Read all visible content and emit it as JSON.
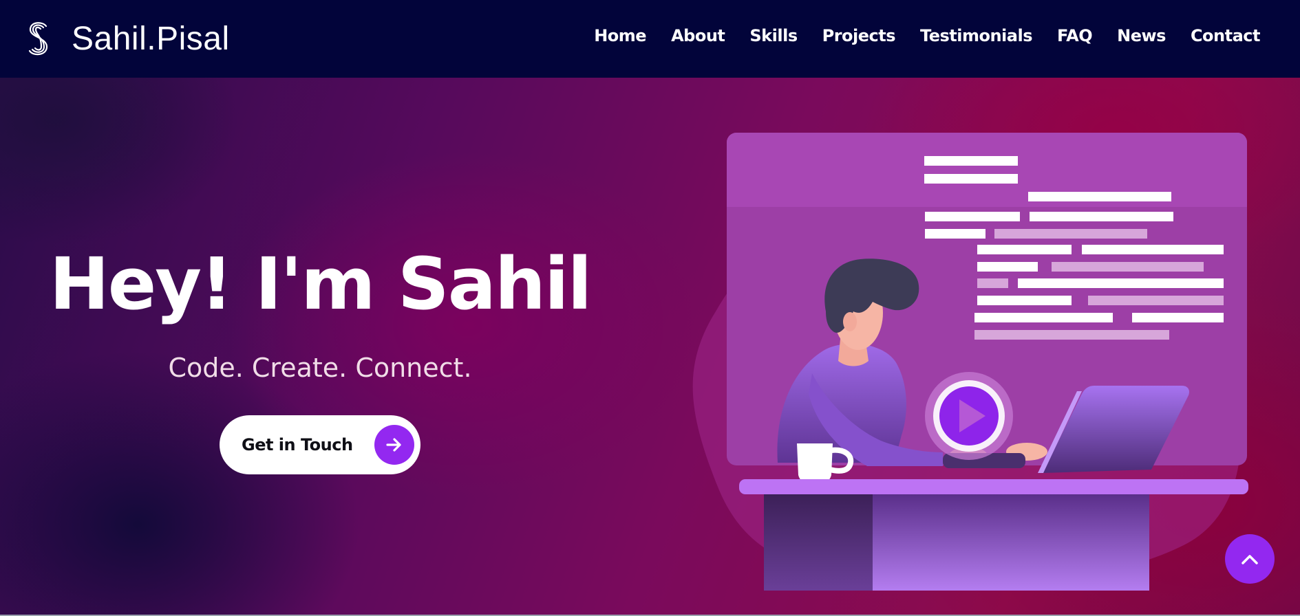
{
  "header": {
    "brand_name": "Sahil.Pisal",
    "logo_icon": "s-logo-icon",
    "nav": [
      "Home",
      "About",
      "Skills",
      "Projects",
      "Testimonials",
      "FAQ",
      "News",
      "Contact"
    ]
  },
  "hero": {
    "title": "Hey! I'm Sahil",
    "subtitle": "Code. Create. Connect.",
    "cta_label": "Get in Touch",
    "cta_icon": "arrow-right-icon",
    "illustration": "developer-at-desk-illustration",
    "back_to_top_icon": "chevron-up-icon"
  },
  "colors": {
    "header_bg": "#02043a",
    "accent": "#9328f0",
    "text": "#ffffff"
  }
}
